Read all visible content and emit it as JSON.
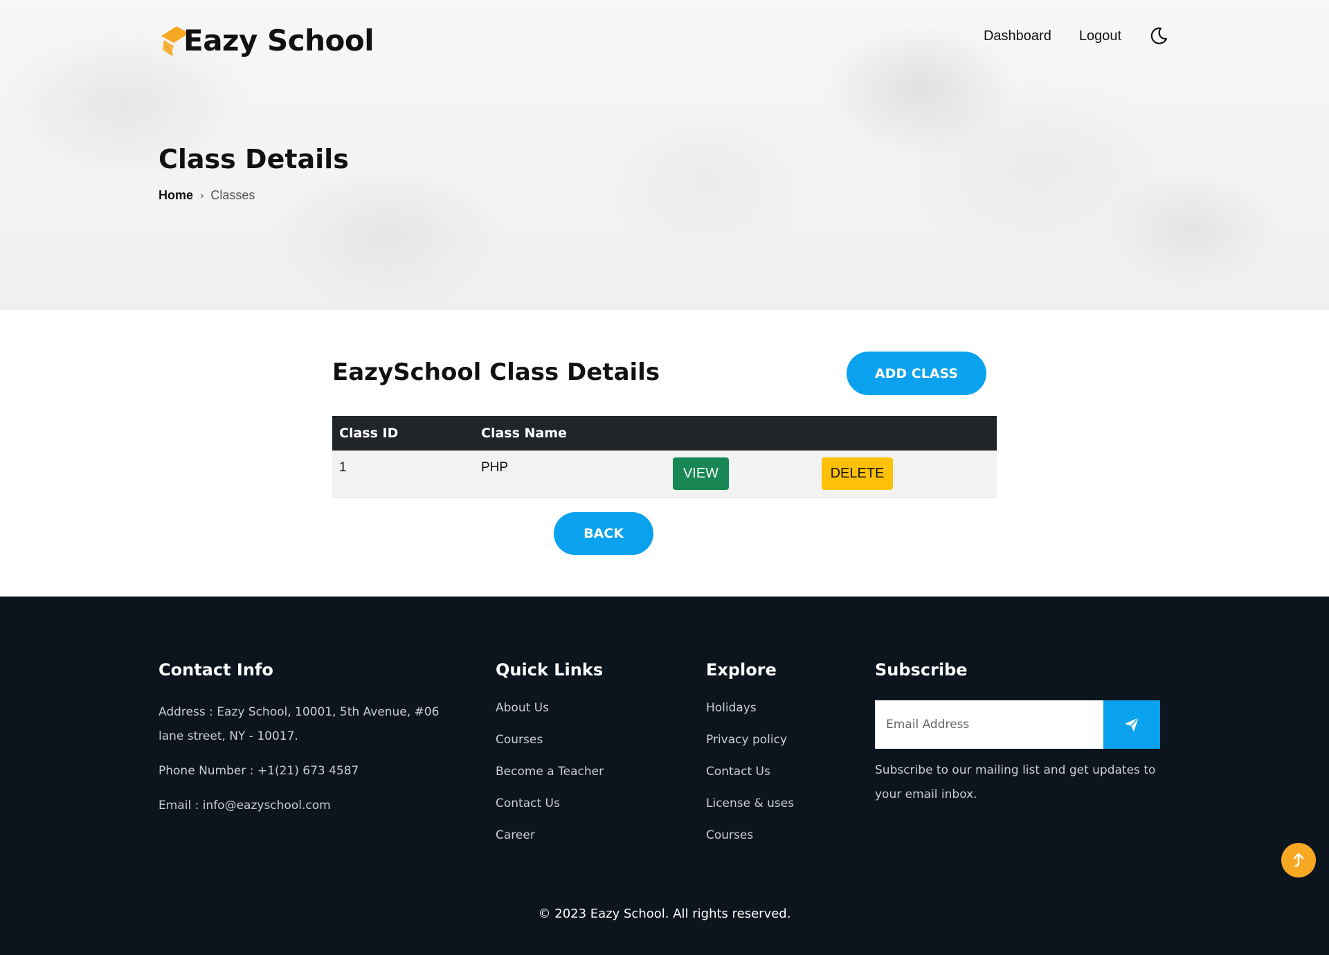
{
  "brand": {
    "name": "Eazy School",
    "accent": "#f7a823"
  },
  "nav": {
    "dashboard": "Dashboard",
    "logout": "Logout",
    "theme_icon": "moon-icon"
  },
  "hero": {
    "title": "Class Details",
    "breadcrumb": {
      "home": "Home",
      "separator": "›",
      "current": "Classes"
    }
  },
  "main": {
    "title": "EazySchool Class Details",
    "add_button": "ADD CLASS",
    "back_button": "BACK",
    "table": {
      "headers": [
        "Class ID",
        "Class Name",
        "",
        ""
      ],
      "rows": [
        {
          "id": "1",
          "name": "PHP",
          "view_label": "VIEW",
          "delete_label": "DELETE"
        }
      ]
    }
  },
  "footer": {
    "contact": {
      "heading": "Contact Info",
      "address": "Address : Eazy School, 10001, 5th Avenue, #06 lane street, NY - 10017.",
      "phone": "Phone Number : +1(21) 673 4587",
      "email": "Email : info@eazyschool.com"
    },
    "quick_links": {
      "heading": "Quick Links",
      "items": [
        "About Us",
        "Courses",
        "Become a Teacher",
        "Contact Us",
        "Career"
      ]
    },
    "explore": {
      "heading": "Explore",
      "items": [
        "Holidays",
        "Privacy policy",
        "Contact Us",
        "License & uses",
        "Courses"
      ]
    },
    "subscribe": {
      "heading": "Subscribe",
      "placeholder": "Email Address",
      "text": "Subscribe to our mailing list and get updates to your email inbox."
    },
    "copyright": "© 2023 Eazy School. All rights reserved."
  },
  "colors": {
    "primary": "#0aa2ee",
    "view": "#198754",
    "delete": "#ffc107",
    "footer_bg": "#0c141d",
    "table_head": "#212529"
  }
}
